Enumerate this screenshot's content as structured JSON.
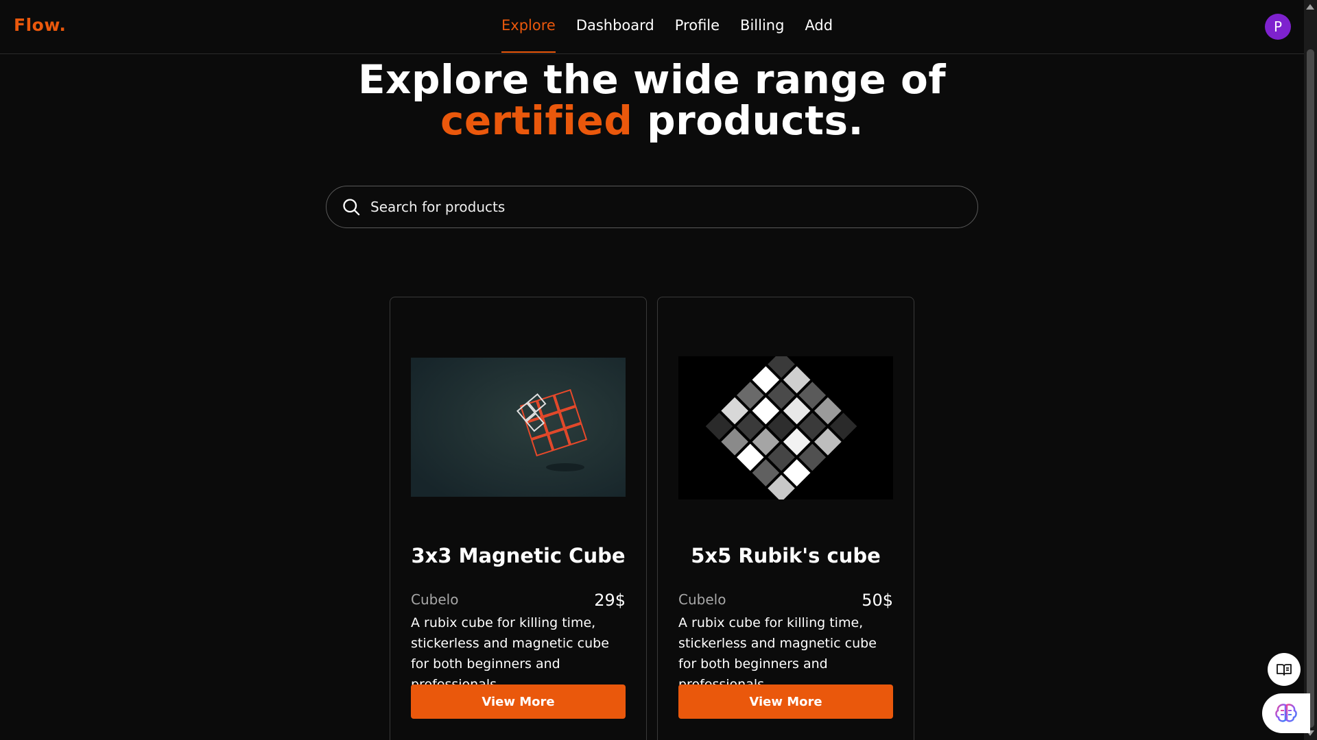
{
  "nav": {
    "logo": "Flow.",
    "links": [
      {
        "label": "Explore",
        "active": true
      },
      {
        "label": "Dashboard"
      },
      {
        "label": "Profile"
      },
      {
        "label": "Billing"
      },
      {
        "label": "Add"
      }
    ],
    "avatar_initial": "P"
  },
  "hero": {
    "line1": "Explore the wide range of",
    "accent": "certified",
    "line2_rest": " products."
  },
  "search": {
    "placeholder": "Search for products",
    "icon": "search-icon"
  },
  "products": [
    {
      "title": "3x3 Magnetic Cube",
      "brand": "Cubelo",
      "price": "29$",
      "description": "A rubix cube for killing time, stickerless and magnetic cube for both beginners and professionals.",
      "button": "View More"
    },
    {
      "title": "5x5 Rubik's cube",
      "brand": "Cubelo",
      "price": "50$",
      "description": "A rubix cube for killing time, stickerless and magnetic cube for both beginners and professionals.",
      "button": "View More"
    }
  ],
  "colors": {
    "accent": "#ea580c",
    "background": "#0b0b0b",
    "avatar": "#7e22ce"
  },
  "floating": {
    "reader_icon": "book-open-icon",
    "assistant_icon": "brain-icon"
  }
}
